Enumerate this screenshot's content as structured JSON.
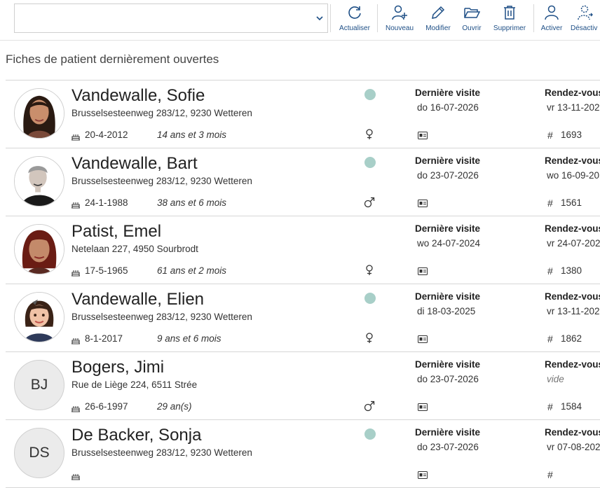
{
  "toolbar": {
    "combo_value": "",
    "buttons": [
      {
        "label": "Actualiser",
        "icon": "refresh-icon"
      },
      {
        "label": "Nouveau",
        "icon": "add-person-icon"
      },
      {
        "label": "Modifier",
        "icon": "pencil-icon"
      },
      {
        "label": "Ouvrir",
        "icon": "folder-open-icon"
      },
      {
        "label": "Supprimer",
        "icon": "trash-icon"
      },
      {
        "label": "Activer",
        "icon": "person-icon"
      },
      {
        "label": "Désactiv",
        "icon": "person-deactivate-icon"
      }
    ]
  },
  "section_title": "Fiches de patient dernièrement ouvertes",
  "colors": {
    "accent": "#1e4f86",
    "status_dot": "#a8cfc8"
  },
  "patients": [
    {
      "name": "Vandewalle, Sofie",
      "address": "Brusselsesteenweg 283/12, 9230 Wetteren",
      "birthdate": "20-4-2012",
      "age": "14 ans et 3 mois",
      "gender": "female",
      "status_dot": true,
      "photo": "photo-woman-dark-hair",
      "last_visit_label": "Dernière visite",
      "last_visit": "do 16-07-2026",
      "rdv_label": "Rendez-vous",
      "rdv": "vr 13-11-202",
      "rdv_empty": false,
      "id": "1693"
    },
    {
      "name": "Vandewalle, Bart",
      "address": "Brusselsesteenweg 283/12, 9230 Wetteren",
      "birthdate": "24-1-1988",
      "age": "38 ans et 6 mois",
      "gender": "male",
      "status_dot": true,
      "photo": "photo-man-grey-hair",
      "last_visit_label": "Dernière visite",
      "last_visit": "do 23-07-2026",
      "rdv_label": "Rendez-vous",
      "rdv": "wo 16-09-20",
      "rdv_empty": false,
      "id": "1561"
    },
    {
      "name": "Patist, Emel",
      "address": "Netelaan 227, 4950 Sourbrodt",
      "birthdate": "17-5-1965",
      "age": "61 ans et 2 mois",
      "gender": "female",
      "status_dot": false,
      "photo": "photo-woman-red-hair",
      "last_visit_label": "Dernière visite",
      "last_visit": "wo 24-07-2024",
      "rdv_label": "Rendez-vous",
      "rdv": "vr 24-07-202",
      "rdv_empty": false,
      "id": "1380"
    },
    {
      "name": "Vandewalle, Elien",
      "address": "Brusselsesteenweg 283/12, 9230 Wetteren",
      "birthdate": "8-1-2017",
      "age": "9 ans et 6 mois",
      "gender": "female",
      "status_dot": true,
      "photo": "photo-girl-child",
      "last_visit_label": "Dernière visite",
      "last_visit": "di 18-03-2025",
      "rdv_label": "Rendez-vous",
      "rdv": "vr 13-11-202",
      "rdv_empty": false,
      "id": "1862"
    },
    {
      "name": "Bogers, Jimi",
      "address": "Rue de Liège 224, 6511 Strée",
      "birthdate": "26-6-1997",
      "age": "29 an(s)",
      "gender": "male",
      "status_dot": false,
      "initials": "BJ",
      "last_visit_label": "Dernière visite",
      "last_visit": "do 23-07-2026",
      "rdv_label": "Rendez-vous",
      "rdv": "vide",
      "rdv_empty": true,
      "id": "1584"
    },
    {
      "name": "De Backer, Sonja",
      "address": "Brusselsesteenweg 283/12, 9230 Wetteren",
      "birthdate": "",
      "age": "",
      "gender": "",
      "status_dot": true,
      "initials": "DS",
      "last_visit_label": "Dernière visite",
      "last_visit": "do 23-07-2026",
      "rdv_label": "Rendez-vous",
      "rdv": "vr 07-08-202",
      "rdv_empty": false,
      "id": ""
    }
  ]
}
